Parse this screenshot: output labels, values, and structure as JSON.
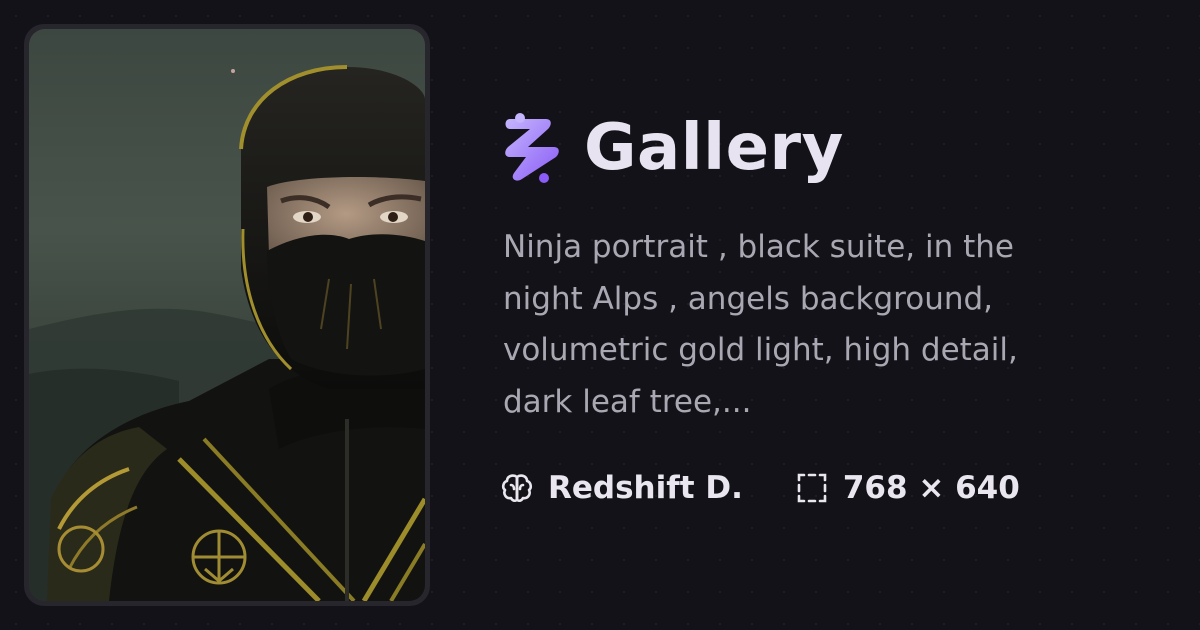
{
  "app": {
    "title": "Gallery",
    "logo_icon": "puzzle-bolt-logo-icon",
    "accent_color": "#a78bfa"
  },
  "image": {
    "icon": "ninja-portrait-image"
  },
  "prompt": {
    "lines": [
      "Ninja portrait , black suite, in the",
      "night Alps , angels background,",
      "volumetric gold light, high detail,",
      "dark leaf tree,..."
    ]
  },
  "meta": {
    "model": {
      "icon": "brain-icon",
      "label": "Redshift D."
    },
    "size": {
      "icon": "dimensions-frame-icon",
      "label": "768 × 640"
    }
  }
}
